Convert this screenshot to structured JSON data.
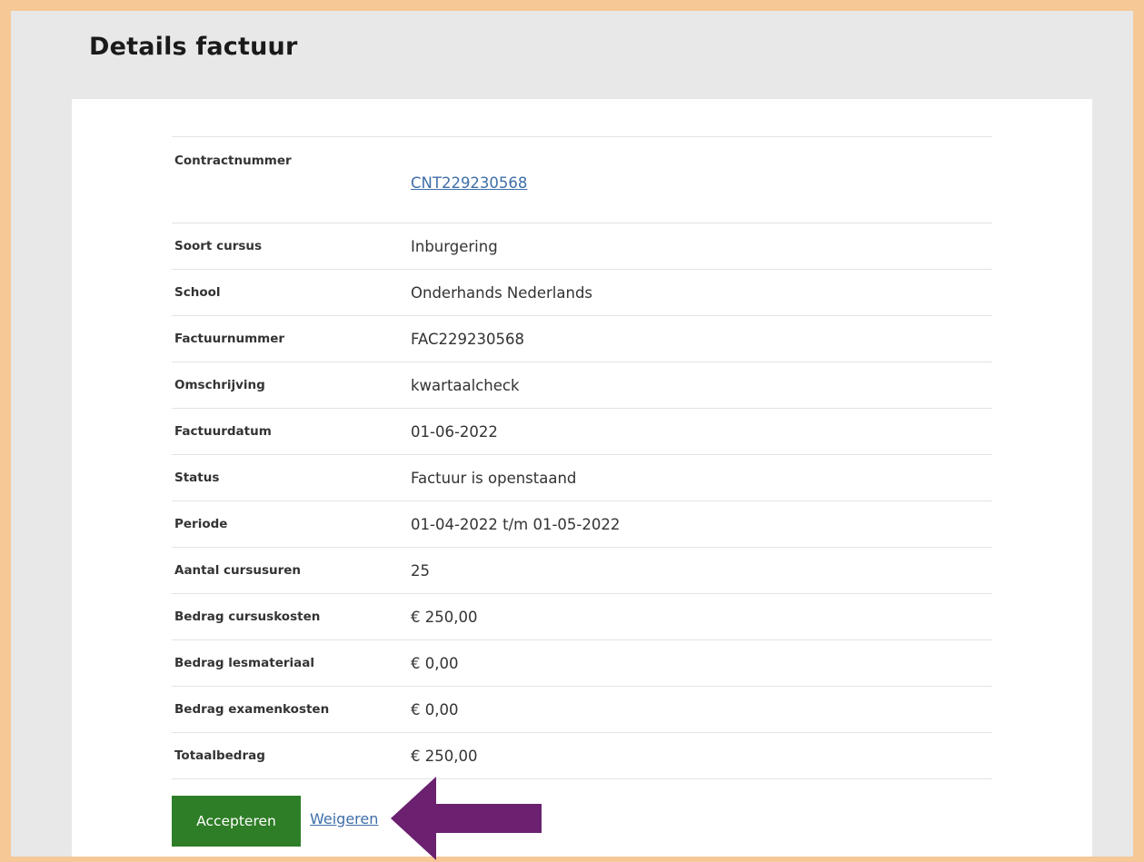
{
  "page": {
    "title": "Details factuur"
  },
  "details": {
    "rows": [
      {
        "label": "Contractnummer",
        "value": "CNT229230568"
      },
      {
        "label": "Soort cursus",
        "value": "Inburgering"
      },
      {
        "label": "School",
        "value": "Onderhands Nederlands"
      },
      {
        "label": "Factuurnummer",
        "value": "FAC229230568"
      },
      {
        "label": "Omschrijving",
        "value": "kwartaalcheck"
      },
      {
        "label": "Factuurdatum",
        "value": "01-06-2022"
      },
      {
        "label": "Status",
        "value": "Factuur is openstaand"
      },
      {
        "label": "Periode",
        "value": "01-04-2022 t/m 01-05-2022"
      },
      {
        "label": "Aantal cursusuren",
        "value": "25"
      },
      {
        "label": "Bedrag cursuskosten",
        "value": "€ 250,00"
      },
      {
        "label": "Bedrag lesmateriaal",
        "value": "€ 0,00"
      },
      {
        "label": "Bedrag examenkosten",
        "value": "€ 0,00"
      },
      {
        "label": "Totaalbedrag",
        "value": "€ 250,00"
      }
    ]
  },
  "actions": {
    "accept_label": "Accepteren",
    "reject_label": "Weigeren"
  },
  "colors": {
    "frame_border": "#f5c896",
    "accept_button": "#2e7d27",
    "link": "#3f6fa8",
    "annotation_arrow": "#6b2070"
  }
}
